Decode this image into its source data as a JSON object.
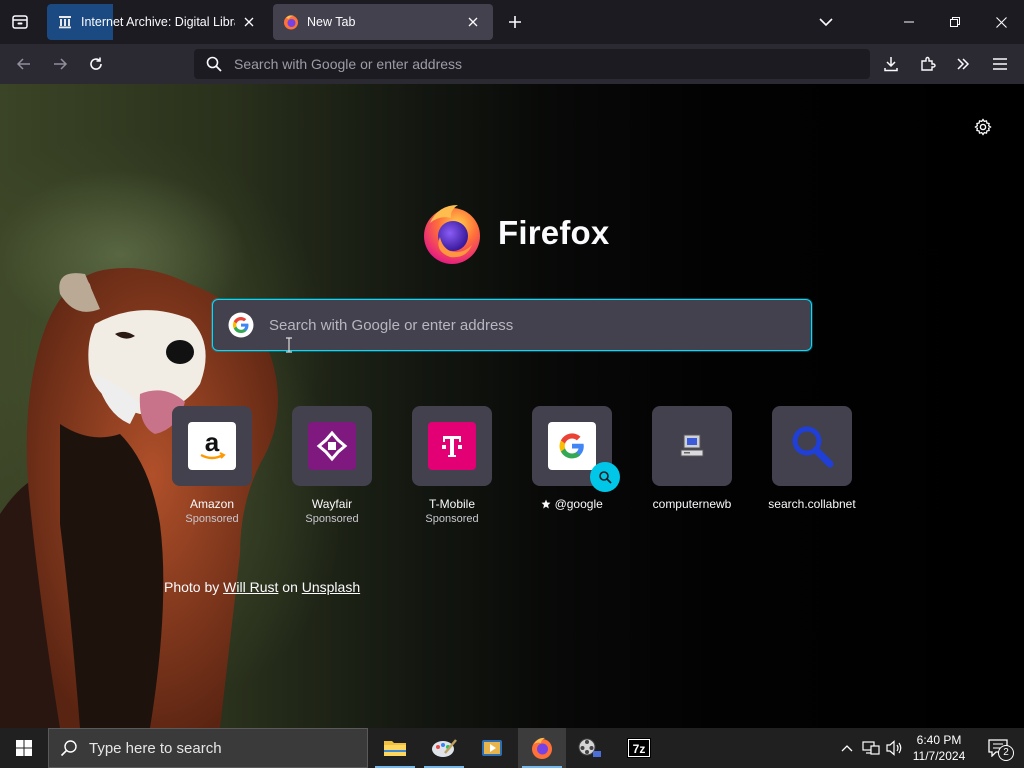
{
  "browser": {
    "tabs": [
      {
        "title": "Internet Archive: Digital Library",
        "active": false,
        "favicon": "archive-building-icon"
      },
      {
        "title": "New Tab",
        "active": true,
        "favicon": "firefox-icon"
      }
    ],
    "urlbar": {
      "placeholder": "Search with Google or enter address"
    }
  },
  "newtab": {
    "brand": "Firefox",
    "search": {
      "placeholder": "Search with Google or enter address"
    },
    "shortcuts": [
      {
        "label": "Amazon",
        "sponsored": "Sponsored",
        "icon": "amazon-logo"
      },
      {
        "label": "Wayfair",
        "sponsored": "Sponsored",
        "icon": "wayfair-logo"
      },
      {
        "label": "T-Mobile",
        "sponsored": "Sponsored",
        "icon": "tmobile-logo"
      },
      {
        "label": "@google",
        "sponsored": "",
        "icon": "google-logo",
        "pinned": true
      },
      {
        "label": "computernewb",
        "sponsored": "",
        "icon": "computer-icon"
      },
      {
        "label": "search.collabnet",
        "sponsored": "",
        "icon": "magnifier-icon"
      }
    ],
    "credit": {
      "prefix": "Photo by",
      "author": "Will Rust",
      "mid": "on",
      "site": "Unsplash"
    }
  },
  "taskbar": {
    "search_placeholder": "Type here to search",
    "time": "6:40 PM",
    "date": "11/7/2024",
    "notifications": "2"
  },
  "colors": {
    "accent": "#00ddff",
    "tab_active": "#42414d",
    "toolbar": "#2b2a33",
    "taskbar": "#202020"
  }
}
